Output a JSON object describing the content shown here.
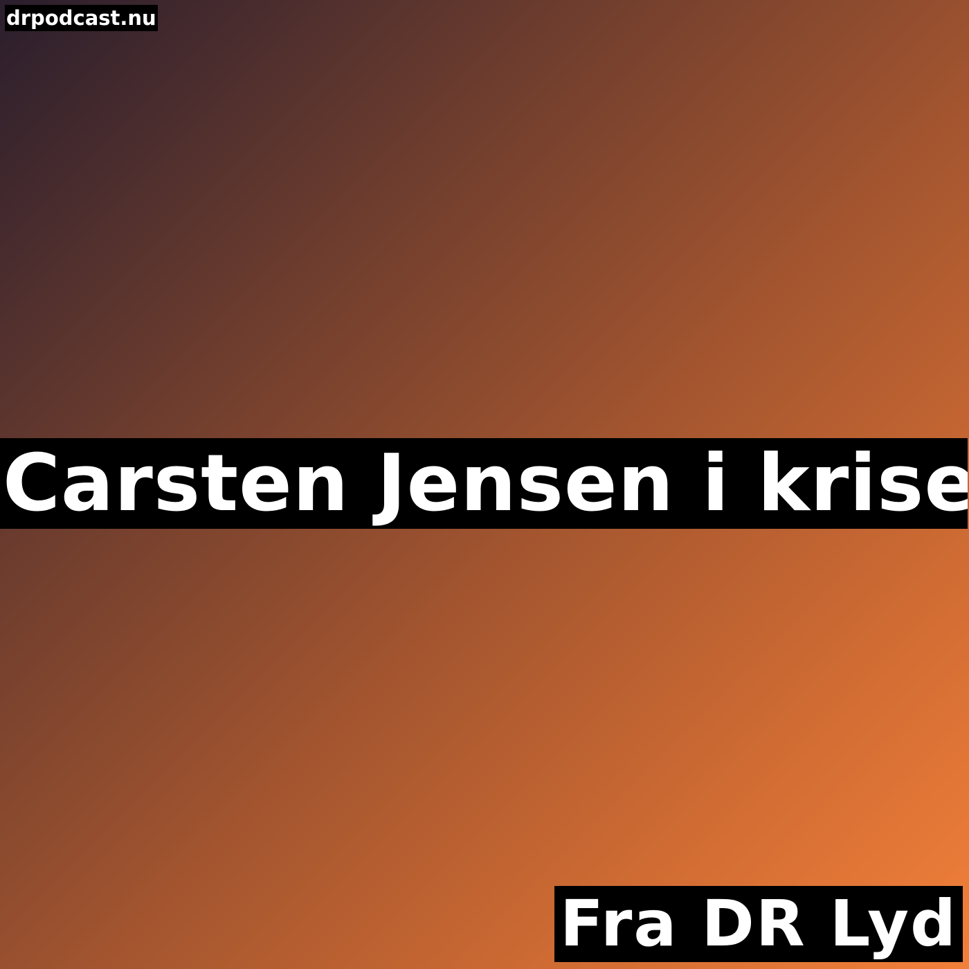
{
  "site": {
    "label": "drpodcast.nu"
  },
  "episode": {
    "title": "Carsten Jensen i krise"
  },
  "source": {
    "label": "Fra DR Lyd"
  },
  "colors": {
    "gradient_start": "#2a1e2d",
    "gradient_end": "#f2803a",
    "label_background": "#000000",
    "label_text": "#ffffff"
  }
}
